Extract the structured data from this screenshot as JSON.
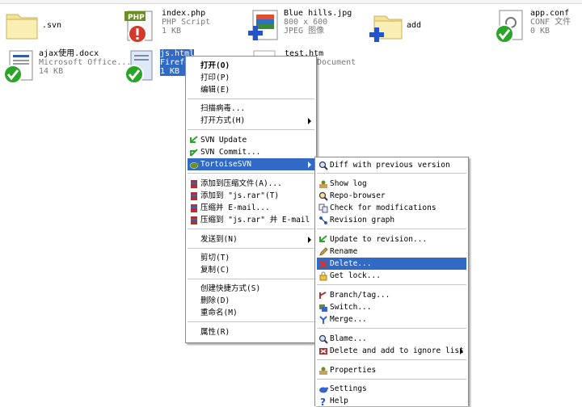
{
  "files": [
    {
      "name": ".svn",
      "line2": "",
      "line3": "",
      "icon": "folder-icon"
    },
    {
      "name": "index.php",
      "line2": "PHP Script",
      "line3": "1 KB",
      "icon": "php-file-conflict-icon"
    },
    {
      "name": "Blue hills.jpg",
      "line2": "800 x 600",
      "line3": "JPEG 图像",
      "icon": "image-file-added-icon"
    },
    {
      "name": "add",
      "line2": "",
      "line3": "",
      "icon": "folder-added-icon"
    },
    {
      "name": "app.conf",
      "line2": "CONF 文件",
      "line3": "0 KB",
      "icon": "conf-file-normal-icon"
    },
    {
      "name": "ajax使用.docx",
      "line2": "Microsoft Office...",
      "line3": "14 KB",
      "icon": "docx-file-normal-icon"
    },
    {
      "name": "js.html",
      "line2": "Firefo",
      "line3": "1 KB",
      "icon": "html-file-normal-icon"
    },
    {
      "name": "test.htm",
      "line2": "Document",
      "line3": "",
      "icon": "htm-file-icon"
    }
  ],
  "context_menu": {
    "items": [
      {
        "label": "打开(O)",
        "bold": true
      },
      {
        "label": "打印(P)"
      },
      {
        "label": "编辑(E)"
      },
      {
        "label": "扫描病毒..."
      },
      {
        "label": "打开方式(H)"
      },
      {
        "label": "SVN Update"
      },
      {
        "label": "SVN Commit..."
      },
      {
        "label": "TortoiseSVN"
      },
      {
        "label": "添加到压缩文件(A)..."
      },
      {
        "label": "添加到 \"js.rar\"(T)"
      },
      {
        "label": "压缩并 E-mail..."
      },
      {
        "label": "压缩到 \"js.rar\" 并 E-mail"
      },
      {
        "label": "发送到(N)"
      },
      {
        "label": "剪切(T)"
      },
      {
        "label": "复制(C)"
      },
      {
        "label": "创建快捷方式(S)"
      },
      {
        "label": "删除(D)"
      },
      {
        "label": "重命名(M)"
      },
      {
        "label": "属性(R)"
      }
    ]
  },
  "tortoise_menu": {
    "items": [
      {
        "label": "Diff with previous version"
      },
      {
        "label": "Show log"
      },
      {
        "label": "Repo-browser"
      },
      {
        "label": "Check for modifications"
      },
      {
        "label": "Revision graph"
      },
      {
        "label": "Update to revision..."
      },
      {
        "label": "Rename"
      },
      {
        "label": "Delete..."
      },
      {
        "label": "Get lock..."
      },
      {
        "label": "Branch/tag..."
      },
      {
        "label": "Switch..."
      },
      {
        "label": "Merge..."
      },
      {
        "label": "Blame..."
      },
      {
        "label": "Delete and add to ignore list"
      },
      {
        "label": "Properties"
      },
      {
        "label": "Settings"
      },
      {
        "label": "Help"
      }
    ]
  },
  "colors": {
    "highlight": "#316ac5",
    "svn_green": "#2aa52a",
    "svn_red": "#d43a2a",
    "svn_blue": "#2255cc"
  }
}
